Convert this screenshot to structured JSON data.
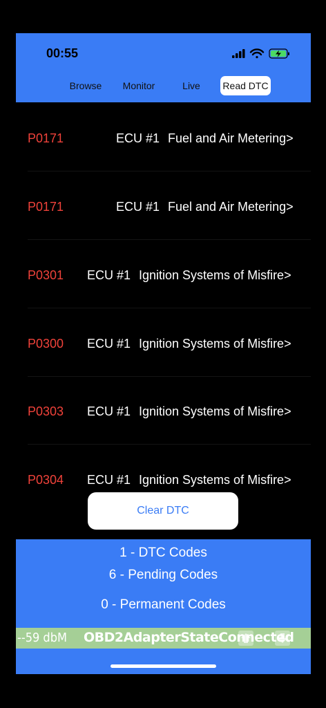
{
  "status_bar": {
    "time": "00:55"
  },
  "tabs": [
    {
      "label": "Browse",
      "active": false
    },
    {
      "label": "Monitor",
      "active": false
    },
    {
      "label": "Live",
      "active": false
    },
    {
      "label": "Read DTC",
      "active": true
    }
  ],
  "dtc_list": [
    {
      "code": "P0171",
      "ecu": "ECU #1",
      "description": "Fuel and Air Metering>"
    },
    {
      "code": "P0171",
      "ecu": "ECU #1",
      "description": "Fuel and Air Metering>"
    },
    {
      "code": "P0301",
      "ecu": "ECU #1",
      "description": "Ignition Systems of Misfire>"
    },
    {
      "code": "P0300",
      "ecu": "ECU #1",
      "description": "Ignition Systems of Misfire>"
    },
    {
      "code": "P0303",
      "ecu": "ECU #1",
      "description": "Ignition Systems of Misfire>"
    },
    {
      "code": "P0304",
      "ecu": "ECU #1",
      "description": "Ignition Systems of Misfire>"
    }
  ],
  "clear_button_label": "Clear DTC",
  "summary": {
    "dtc_codes": "1 - DTC Codes",
    "pending_codes": "6 - Pending Codes",
    "permanent_codes": "0 - Permanent Codes"
  },
  "adapter": {
    "signal": "--59 dbM",
    "state": "OBD2AdapterStateConnected"
  },
  "colors": {
    "accent": "#3a7cf5",
    "code_red": "#f0423a",
    "adapter_bar": "#a5cf96"
  }
}
